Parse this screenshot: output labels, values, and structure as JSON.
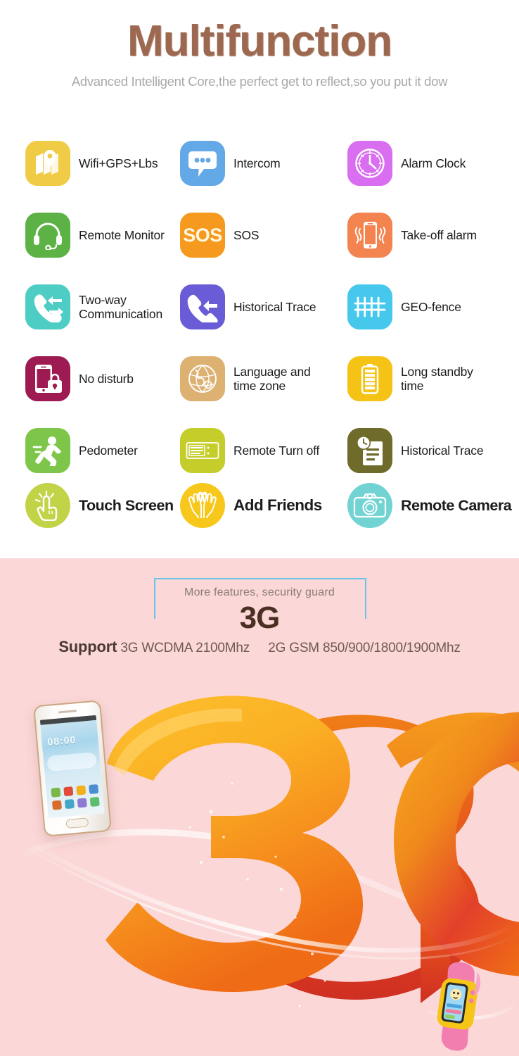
{
  "header": {
    "title": "Multifunction",
    "subtitle": "Advanced Intelligent Core,the perfect get to reflect,so you put it dow"
  },
  "features": [
    {
      "label": "Wifi+GPS+Lbs",
      "icon": "map-pin-icon",
      "color": "#f0cb45",
      "shape": "rounded"
    },
    {
      "label": "Intercom",
      "icon": "chat-bubble-icon",
      "color": "#63a9e8",
      "shape": "rounded"
    },
    {
      "label": "Alarm Clock",
      "icon": "clock-icon",
      "color": "#d96ef0",
      "shape": "rounded"
    },
    {
      "label": "Remote Monitor",
      "icon": "headset-icon",
      "color": "#5cb245",
      "shape": "rounded"
    },
    {
      "label": "SOS",
      "icon": "sos-icon",
      "color": "#f59a1e",
      "shape": "rounded"
    },
    {
      "label": "Take-off  alarm",
      "icon": "vibrating-phone-icon",
      "color": "#f3834f",
      "shape": "rounded"
    },
    {
      "label": "Two-way\nCommunication",
      "icon": "two-way-call-icon",
      "color": "#4ecdc4",
      "shape": "rounded"
    },
    {
      "label": "Historical Trace",
      "icon": "incoming-call-icon",
      "color": "#6a5bd6",
      "shape": "rounded"
    },
    {
      "label": "GEO-fence",
      "icon": "fence-icon",
      "color": "#45c8ec",
      "shape": "rounded"
    },
    {
      "label": "No disturb",
      "icon": "phone-lock-icon",
      "color": "#9e1a52",
      "shape": "rounded"
    },
    {
      "label": "Language and\ntime zone",
      "icon": "globe-icon",
      "color": "#ddb172",
      "shape": "rounded"
    },
    {
      "label": "Long standby\ntime",
      "icon": "battery-icon",
      "color": "#f5c315",
      "shape": "rounded"
    },
    {
      "label": "Pedometer",
      "icon": "running-person-icon",
      "color": "#7ec64a",
      "shape": "rounded"
    },
    {
      "label": "Remote Turn off",
      "icon": "server-icon",
      "color": "#c5cd2a",
      "shape": "rounded"
    },
    {
      "label": "Historical Trace",
      "icon": "clock-document-icon",
      "color": "#6e6b2b",
      "shape": "rounded"
    },
    {
      "label": "Touch Screen",
      "icon": "touch-finger-icon",
      "color": "#c2d348",
      "shape": "circle"
    },
    {
      "label": "Add Friends",
      "icon": "two-hands-icon",
      "color": "#f7c81b",
      "shape": "circle"
    },
    {
      "label": "Remote Camera",
      "icon": "camera-icon",
      "color": "#72d3d3",
      "shape": "circle"
    }
  ],
  "promo": {
    "tagline": "More features, security guard",
    "network": "3G",
    "support_prefix": "Support",
    "support_3g": "3G WCDMA 2100Mhz",
    "support_2g": "2G GSM 850/900/1800/1900Mhz",
    "bracket_color": "#6cc5e8",
    "background_color": "#fbd7d7"
  },
  "hero": {
    "big_text": "3G",
    "phone_clock": "08:00"
  }
}
